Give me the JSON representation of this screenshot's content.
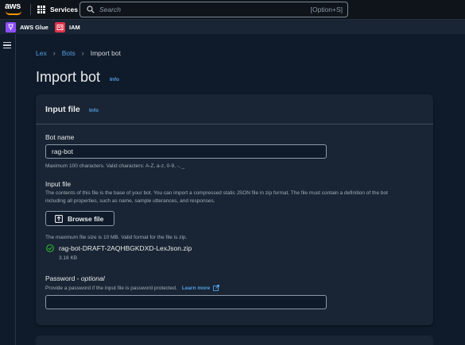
{
  "topnav": {
    "logo_text": "aws",
    "services_label": "Services",
    "search_placeholder": "Search",
    "search_shortcut": "[Option+S]"
  },
  "favorites": [
    {
      "label": "AWS Glue",
      "icon": "glue-service-icon",
      "color": "#8c4fff"
    },
    {
      "label": "IAM",
      "icon": "iam-service-icon",
      "color": "#dd344c"
    }
  ],
  "breadcrumb": {
    "items": [
      "Lex",
      "Bots"
    ],
    "current": "Import bot"
  },
  "page": {
    "title": "Import bot",
    "info_label": "Info"
  },
  "panel": {
    "title": "Input file",
    "info_label": "Info",
    "bot_name": {
      "label": "Bot name",
      "value": "rag-bot",
      "constraint": "Maximum 100 characters. Valid characters: A-Z, a-z, 0-9, -, _"
    },
    "input_file": {
      "label": "Input file",
      "description": "The contents of this file is the base of your bot. You can import a compressed static JSON file in zip format. The file must contain a definition of the bot including all properties, such as name, sample utterances, and responses.",
      "browse_label": "Browse file",
      "constraint": "The maximum file size is 10 MB. Valid format for the file is zip.",
      "selected_file": "rag-bot-DRAFT-2AQHBGKDXD-LexJson.zip",
      "selected_size": "3.18 KB"
    },
    "password": {
      "label": "Password - ",
      "label_optional": "optional",
      "description": "Provide a password if the input file is password protected.",
      "learn_more": "Learn more",
      "value": ""
    }
  },
  "colors": {
    "accent_link": "#539fe5",
    "success": "#29ad32",
    "aws_orange": "#ff9900"
  }
}
